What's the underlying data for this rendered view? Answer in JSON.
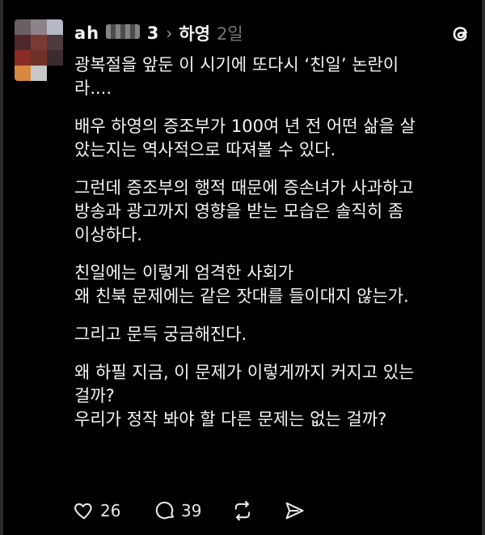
{
  "header": {
    "username_visible": "ah",
    "username_tail": "3",
    "mention": "하영",
    "time": "2일"
  },
  "post": {
    "p1": [
      "광복절을 앞둔 이 시기에 또다시 ‘친일’ 논란이",
      "라...."
    ],
    "p2": [
      "배우 하영의 증조부가 100여 년 전 어떤 삶을 살",
      "았는지는 역사적으로 따져볼 수 있다."
    ],
    "p3": [
      "그런데 증조부의 행적 때문에 증손녀가 사과하고",
      "방송과 광고까지 영향을 받는 모습은 솔직히 좀",
      "이상하다."
    ],
    "p4": [
      "친일에는 이렇게 엄격한 사회가",
      "왜 친북 문제에는 같은 잣대를 들이대지 않는가."
    ],
    "p5": [
      "그리고 문득 궁금해진다."
    ],
    "p6": [
      "왜 하필 지금, 이 문제가 이렇게까지 커지고 있는",
      "걸까?",
      "우리가 정작 봐야 할 다른 문제는 없는 걸까?"
    ]
  },
  "actions": {
    "likes": "26",
    "comments": "39"
  },
  "icons": [
    "heart-icon",
    "comment-icon",
    "repost-icon",
    "share-icon",
    "threads-logo-icon"
  ]
}
